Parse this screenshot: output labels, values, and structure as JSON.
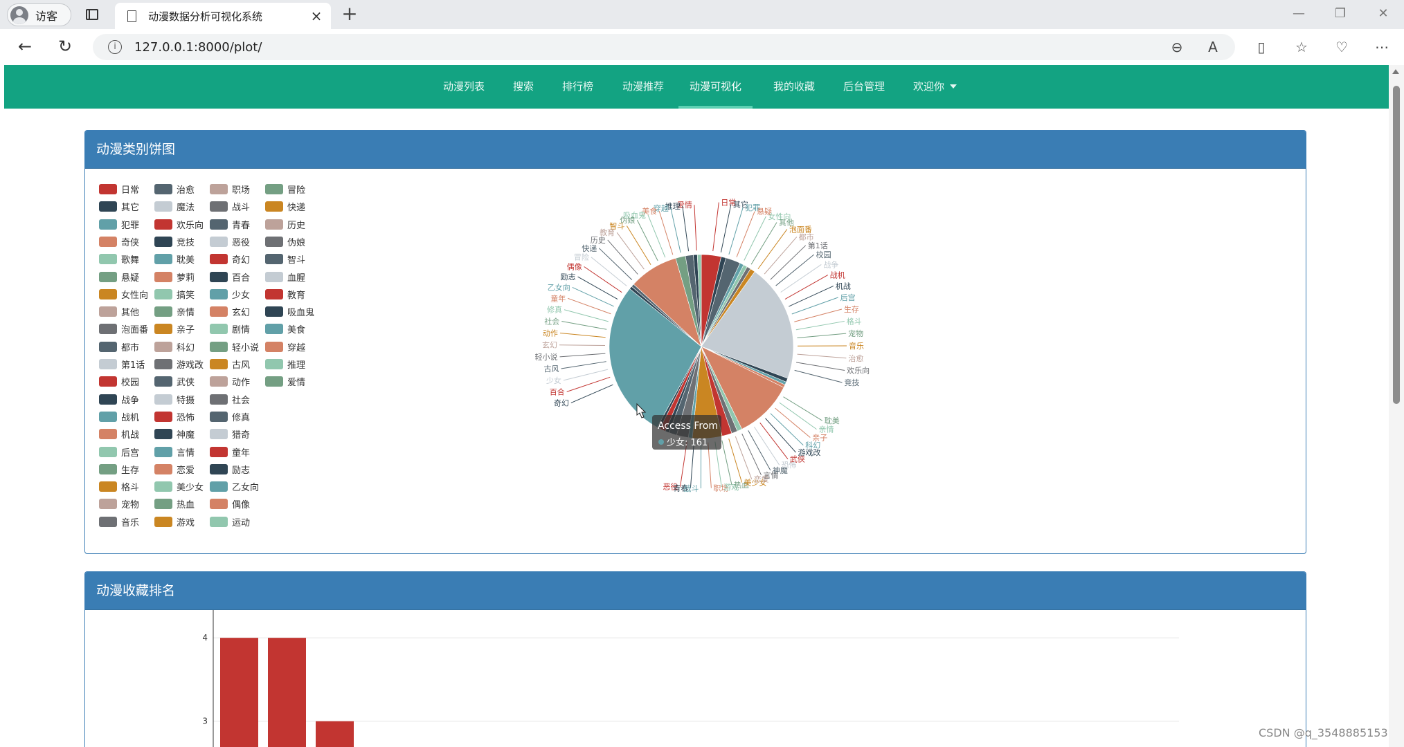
{
  "browser": {
    "profile_label": "访客",
    "tab_title": "动漫数据分析可视化系统",
    "url": "127.0.0.1:8000/plot/"
  },
  "nav": {
    "items": [
      "动漫列表",
      "搜索",
      "排行榜",
      "动漫推荐",
      "动漫可视化",
      "我的收藏",
      "后台管理"
    ],
    "active_index": 4,
    "welcome": "欢迎你"
  },
  "pie_panel": {
    "title": "动漫类别饼图",
    "tooltip_title": "Access From",
    "tooltip_text": "少女: 161"
  },
  "bar_panel": {
    "title": "动漫收藏排名"
  },
  "legend_columns": [
    [
      [
        "日常",
        "#c23531"
      ],
      [
        "其它",
        "#2f4554"
      ],
      [
        "犯罪",
        "#61a0a8"
      ],
      [
        "奇侠",
        "#d48265"
      ],
      [
        "歌舞",
        "#91c7ae"
      ],
      [
        "悬疑",
        "#749f83"
      ],
      [
        "女性向",
        "#ca8622"
      ],
      [
        "其他",
        "#bda29a"
      ],
      [
        "泡面番",
        "#6e7074"
      ],
      [
        "都市",
        "#546570"
      ],
      [
        "第1话",
        "#c4ccd3"
      ],
      [
        "校园",
        "#c23531"
      ],
      [
        "战争",
        "#2f4554"
      ],
      [
        "战机",
        "#61a0a8"
      ],
      [
        "机战",
        "#d48265"
      ],
      [
        "后宫",
        "#91c7ae"
      ],
      [
        "生存",
        "#749f83"
      ],
      [
        "格斗",
        "#ca8622"
      ],
      [
        "宠物",
        "#bda29a"
      ],
      [
        "音乐",
        "#6e7074"
      ]
    ],
    [
      [
        "治愈",
        "#546570"
      ],
      [
        "魔法",
        "#c4ccd3"
      ],
      [
        "欢乐向",
        "#c23531"
      ],
      [
        "竞技",
        "#2f4554"
      ],
      [
        "耽美",
        "#61a0a8"
      ],
      [
        "萝莉",
        "#d48265"
      ],
      [
        "搞笑",
        "#91c7ae"
      ],
      [
        "亲情",
        "#749f83"
      ],
      [
        "亲子",
        "#ca8622"
      ],
      [
        "科幻",
        "#bda29a"
      ],
      [
        "游戏改",
        "#6e7074"
      ],
      [
        "武侠",
        "#546570"
      ],
      [
        "特摄",
        "#c4ccd3"
      ],
      [
        "恐怖",
        "#c23531"
      ],
      [
        "神魔",
        "#2f4554"
      ],
      [
        "言情",
        "#61a0a8"
      ],
      [
        "恋爱",
        "#d48265"
      ],
      [
        "美少女",
        "#91c7ae"
      ],
      [
        "热血",
        "#749f83"
      ],
      [
        "游戏",
        "#ca8622"
      ]
    ],
    [
      [
        "职场",
        "#bda29a"
      ],
      [
        "战斗",
        "#6e7074"
      ],
      [
        "青春",
        "#546570"
      ],
      [
        "恶役",
        "#c4ccd3"
      ],
      [
        "奇幻",
        "#c23531"
      ],
      [
        "百合",
        "#2f4554"
      ],
      [
        "少女",
        "#61a0a8"
      ],
      [
        "玄幻",
        "#d48265"
      ],
      [
        "剧情",
        "#91c7ae"
      ],
      [
        "轻小说",
        "#749f83"
      ],
      [
        "古风",
        "#ca8622"
      ],
      [
        "动作",
        "#bda29a"
      ],
      [
        "社会",
        "#6e7074"
      ],
      [
        "修真",
        "#546570"
      ],
      [
        "猎奇",
        "#c4ccd3"
      ],
      [
        "童年",
        "#c23531"
      ],
      [
        "励志",
        "#2f4554"
      ],
      [
        "乙女向",
        "#61a0a8"
      ],
      [
        "偶像",
        "#d48265"
      ],
      [
        "运动",
        "#91c7ae"
      ]
    ],
    [
      [
        "冒险",
        "#749f83"
      ],
      [
        "快递",
        "#ca8622"
      ],
      [
        "历史",
        "#bda29a"
      ],
      [
        "伪娘",
        "#6e7074"
      ],
      [
        "智斗",
        "#546570"
      ],
      [
        "血腥",
        "#c4ccd3"
      ],
      [
        "教育",
        "#c23531"
      ],
      [
        "吸血鬼",
        "#2f4554"
      ],
      [
        "美食",
        "#61a0a8"
      ],
      [
        "穿越",
        "#d48265"
      ],
      [
        "推理",
        "#91c7ae"
      ],
      [
        "爱情",
        "#749f83"
      ]
    ]
  ],
  "chart_data": [
    {
      "type": "pie",
      "title": "动漫类别饼图",
      "slices": [
        {
          "name": "日常",
          "value": 20,
          "color": "#c23531"
        },
        {
          "name": "其它",
          "value": 5,
          "color": "#2f4554"
        },
        {
          "name": "治愈",
          "value": 15,
          "color": "#546570"
        },
        {
          "name": "犯罪",
          "value": 4,
          "color": "#61a0a8"
        },
        {
          "name": "战斗",
          "value": 4,
          "color": "#91c7ae"
        },
        {
          "name": "机战",
          "value": 4,
          "color": "#6e7074"
        },
        {
          "name": "格斗",
          "value": 5,
          "color": "#ca8622"
        },
        {
          "name": "欢乐向",
          "value": 120,
          "color": "#c4ccd3"
        },
        {
          "name": "竞技",
          "value": 4,
          "color": "#2f4554"
        },
        {
          "name": "耽美",
          "value": 3,
          "color": "#61a0a8"
        },
        {
          "name": "萝莉",
          "value": 3,
          "color": "#d48265"
        },
        {
          "name": "搞笑",
          "value": 60,
          "color": "#d48265"
        },
        {
          "name": "亲子",
          "value": 5,
          "color": "#91c7ae"
        },
        {
          "name": "游戏改",
          "value": 6,
          "color": "#6e7074"
        },
        {
          "name": "恐怖",
          "value": 10,
          "color": "#c23531"
        },
        {
          "name": "神魔",
          "value": 30,
          "color": "#ca8622"
        },
        {
          "name": "言情",
          "value": 4,
          "color": "#61a0a8"
        },
        {
          "name": "恋爱",
          "value": 12,
          "color": "#6e7074"
        },
        {
          "name": "美少女",
          "value": 8,
          "color": "#546570"
        },
        {
          "name": "职场",
          "value": 4,
          "color": "#2f4554"
        },
        {
          "name": "奇幻",
          "value": 6,
          "color": "#c23531"
        },
        {
          "name": "百合",
          "value": 3,
          "color": "#2f4554"
        },
        {
          "name": "少女",
          "value": 161,
          "color": "#61a0a8"
        },
        {
          "name": "乙女向",
          "value": 3,
          "color": "#2f4554"
        },
        {
          "name": "励志",
          "value": 3,
          "color": "#546570"
        },
        {
          "name": "偶像",
          "value": 50,
          "color": "#d48265"
        },
        {
          "name": "冒险",
          "value": 10,
          "color": "#749f83"
        },
        {
          "name": "智斗",
          "value": 8,
          "color": "#546570"
        },
        {
          "name": "吸血鬼",
          "value": 4,
          "color": "#2f4554"
        },
        {
          "name": "教育",
          "value": 4,
          "color": "#91c7ae"
        }
      ],
      "outer_labels": {
        "right": [
          "爱情",
          "推理",
          "穿越",
          "美食",
          "吸血鬼",
          "伪娘",
          "智斗",
          "教育",
          "历史",
          "快递",
          "冒险",
          "偶像",
          "励志",
          "乙女向",
          "童年",
          "修真",
          "社会",
          "动作",
          "玄幻",
          "轻小说",
          "古风",
          "少女",
          "百合",
          "奇幻"
        ],
        "left_bottom": [
          "恶役",
          "青春",
          "战斗",
          "职场",
          "游戏",
          "热血",
          "美少女",
          "恋爱",
          "言情",
          "神魔",
          "恐怖",
          "武侠",
          "游戏改",
          "科幻",
          "亲子",
          "亲情",
          "耽美"
        ],
        "top_right": [
          "日常",
          "其它",
          "犯罪",
          "悬疑",
          "女性向",
          "其他",
          "泡面番",
          "都市",
          "第1话",
          "校园",
          "战争",
          "战机",
          "机战",
          "后宫",
          "生存",
          "格斗",
          "宠物",
          "音乐",
          "治愈",
          "欢乐向",
          "竞技"
        ]
      }
    },
    {
      "type": "bar",
      "title": "动漫收藏排名",
      "values": [
        4,
        4,
        3
      ],
      "y_ticks": [
        3,
        4
      ],
      "ylim": [
        2.55,
        4.3
      ],
      "color": "#c23531"
    }
  ],
  "watermark": "CSDN @q_3548885153"
}
